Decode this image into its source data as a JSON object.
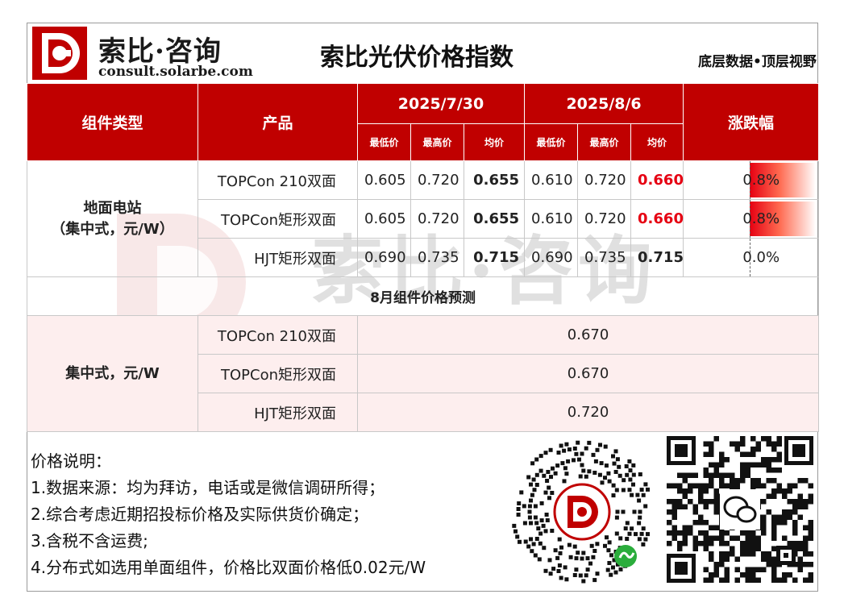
{
  "brand": {
    "name": "索比·咨询",
    "url": "consult.solarbe.com",
    "slogan": "底层数据•顶层视野"
  },
  "title": "索比光伏价格指数",
  "watermark": {
    "text": "索比·咨询",
    "url": "consult.solarbe.com"
  },
  "colors": {
    "header_red": "#c00000",
    "price_up_red": "#e60012",
    "forecast_bg": "#fdeeee"
  },
  "table": {
    "headers": {
      "type": "组件类型",
      "product": "产品",
      "date1": "2025/7/30",
      "date2": "2025/8/6",
      "change": "涨跌幅",
      "sub": {
        "low": "最低价",
        "high": "最高价",
        "avg": "均价"
      }
    },
    "category": {
      "line1": "地面电站",
      "line2": "（集中式，元/W）"
    },
    "rows": [
      {
        "product": "TOPCon 210双面",
        "d1_low": "0.605",
        "d1_high": "0.720",
        "d1_avg": "0.655",
        "d2_low": "0.610",
        "d2_high": "0.720",
        "d2_avg": "0.660",
        "change": "0.8%",
        "change_value": 0.8,
        "up": true
      },
      {
        "product": "TOPCon矩形双面",
        "d1_low": "0.605",
        "d1_high": "0.720",
        "d1_avg": "0.655",
        "d2_low": "0.610",
        "d2_high": "0.720",
        "d2_avg": "0.660",
        "change": "0.8%",
        "change_value": 0.8,
        "up": true
      },
      {
        "product": "HJT矩形双面",
        "d1_low": "0.690",
        "d1_high": "0.735",
        "d1_avg": "0.715",
        "d2_low": "0.690",
        "d2_high": "0.735",
        "d2_avg": "0.715",
        "change": "0.0%",
        "change_value": 0.0,
        "up": false
      }
    ],
    "forecast": {
      "title": "8月组件价格预测",
      "category": "集中式，元/W",
      "rows": [
        {
          "product": "TOPCon 210双面",
          "value": "0.670"
        },
        {
          "product": "TOPCon矩形双面",
          "value": "0.670"
        },
        {
          "product": "HJT矩形双面",
          "value": "0.720"
        }
      ]
    }
  },
  "notes": {
    "heading": "价格说明：",
    "items": [
      "1.数据来源：均为拜访，电话或是微信调研所得；",
      "2.综合考虑近期招投标价格及实际供货价确定；",
      "3.含税不含运费;",
      "4.分布式如选用单面组件，价格比双面价格低0.02元/W"
    ]
  },
  "qr": {
    "miniprogram": "mini-program-qr-icon",
    "wechat": "wechat-qr-icon"
  }
}
